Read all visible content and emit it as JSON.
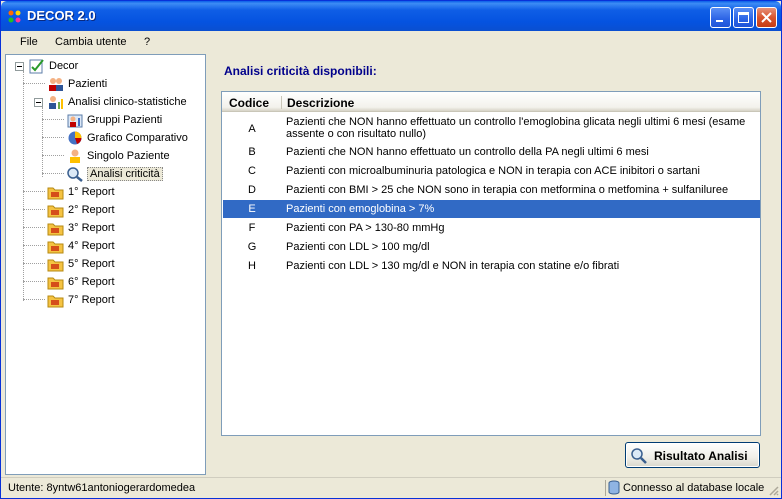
{
  "window": {
    "title": "DECOR 2.0"
  },
  "menu": {
    "items": [
      "File",
      "Cambia utente",
      "?"
    ]
  },
  "tree": {
    "root": "Decor",
    "items": [
      {
        "label": "Pazienti",
        "icon": "patients-icon"
      },
      {
        "label": "Analisi clinico-statistiche",
        "icon": "stats-icon"
      },
      {
        "label": "Gruppi Pazienti",
        "icon": "group-chart-icon"
      },
      {
        "label": "Grafico Comparativo",
        "icon": "pie-chart-icon"
      },
      {
        "label": "Singolo Paziente",
        "icon": "single-patient-icon"
      },
      {
        "label": "Analisi criticità",
        "icon": "magnifier-icon"
      },
      {
        "label": "1° Report",
        "icon": "folder-report-icon"
      },
      {
        "label": "2° Report",
        "icon": "folder-report-icon"
      },
      {
        "label": "3° Report",
        "icon": "folder-report-icon"
      },
      {
        "label": "4° Report",
        "icon": "folder-report-icon"
      },
      {
        "label": "5° Report",
        "icon": "folder-report-icon"
      },
      {
        "label": "6° Report",
        "icon": "folder-report-icon"
      },
      {
        "label": "7° Report",
        "icon": "folder-report-icon"
      }
    ]
  },
  "content": {
    "title": "Analisi criticità disponibili:",
    "columns": {
      "code": "Codice",
      "description": "Descrizione"
    },
    "rows": [
      {
        "code": "A",
        "description": "Pazienti che NON hanno effettuato un controllo l'emoglobina glicata negli ultimi 6 mesi (esame assente o con risultato nullo)"
      },
      {
        "code": "B",
        "description": "Pazienti che NON hanno effettuato un controllo della PA negli ultimi 6 mesi"
      },
      {
        "code": "C",
        "description": "Pazienti con microalbuminuria patologica e NON in terapia con ACE inibitori o sartani"
      },
      {
        "code": "D",
        "description": "Pazienti con BMI > 25 che NON sono in terapia con metformina o metfomina + sulfaniluree"
      },
      {
        "code": "E",
        "description": "Pazienti con emoglobina > 7%"
      },
      {
        "code": "F",
        "description": "Pazienti con PA > 130-80 mmHg"
      },
      {
        "code": "G",
        "description": "Pazienti con LDL > 100 mg/dl"
      },
      {
        "code": "H",
        "description": "Pazienti con LDL > 130 mg/dl e NON in terapia con statine e/o fibrati"
      }
    ],
    "selected_code": "E",
    "button_label": "Risultato Analisi"
  },
  "status": {
    "user": "Utente: 8yntw61antoniogerardomedea",
    "connection": "Connesso al database locale"
  },
  "colors": {
    "selection": "#316ac5",
    "title_bar": "#0553e0",
    "heading": "#00008b"
  }
}
